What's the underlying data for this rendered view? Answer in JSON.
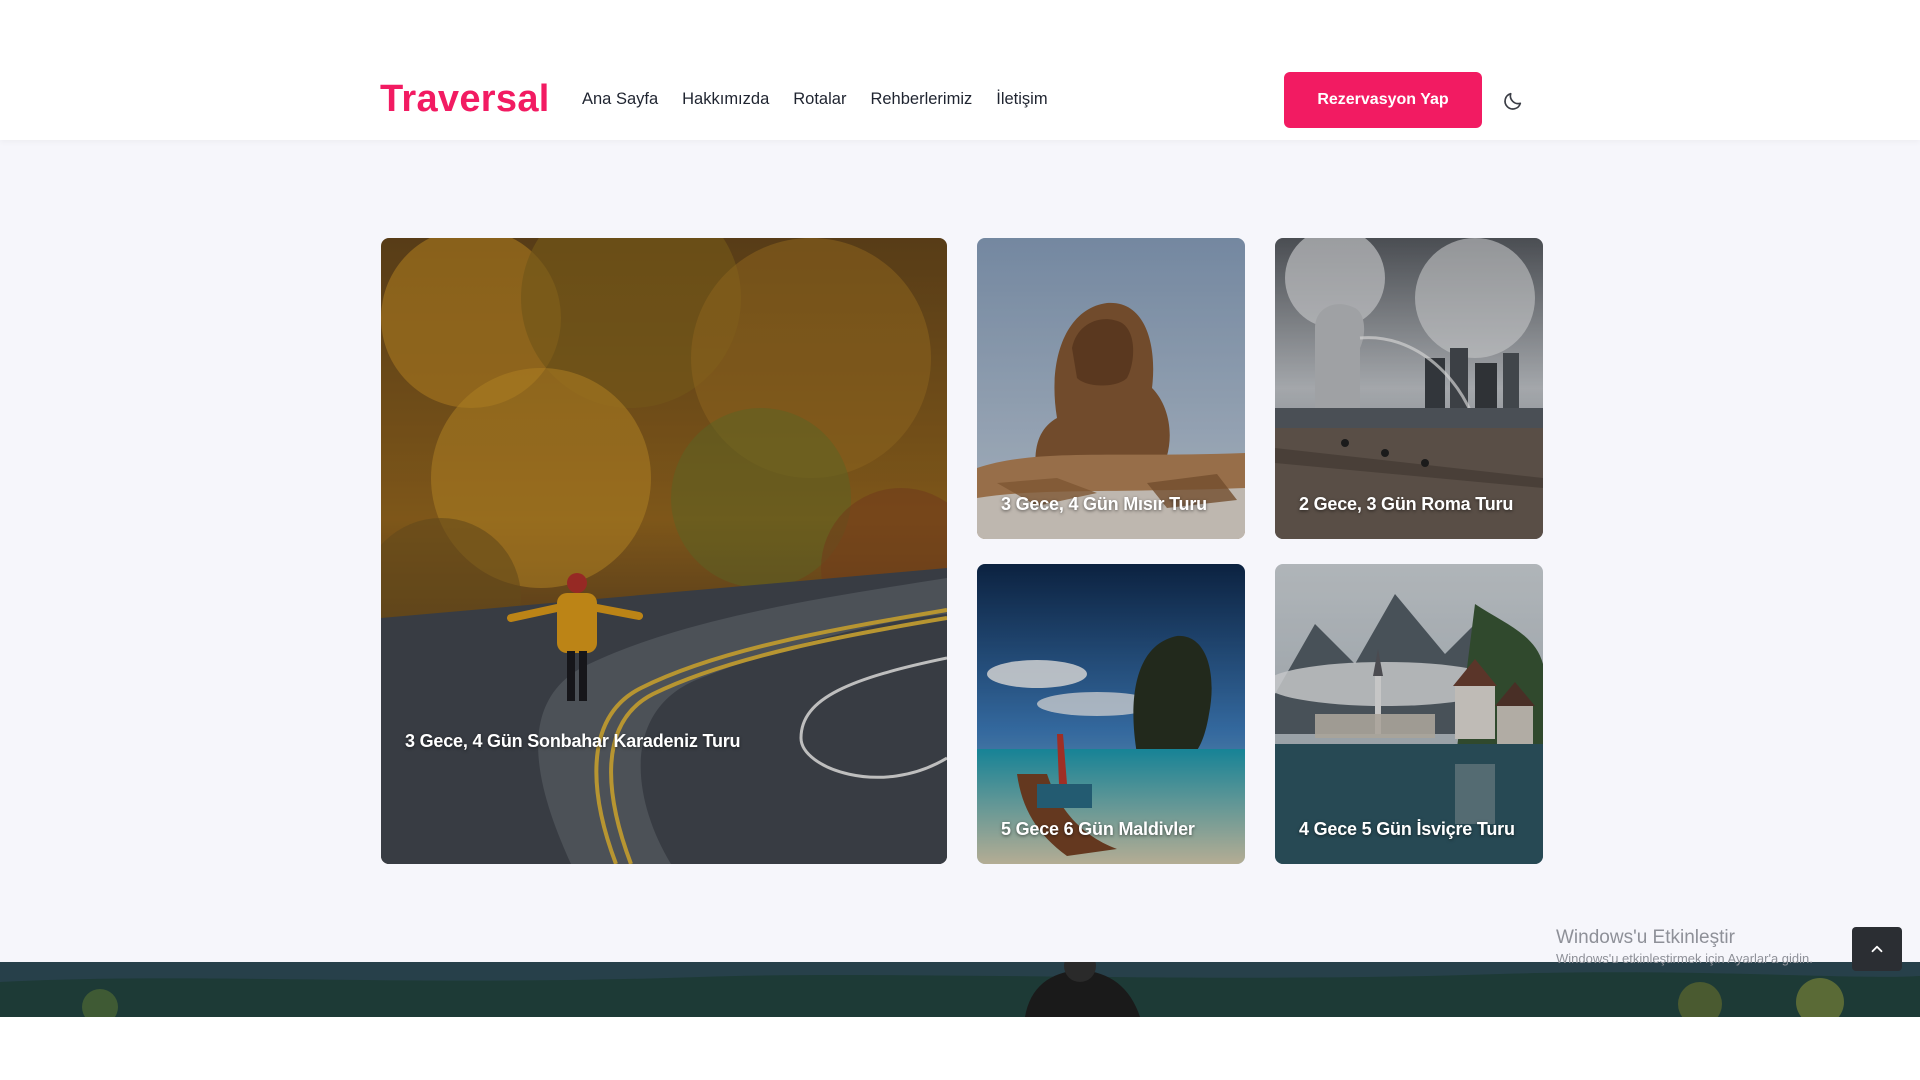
{
  "header": {
    "logo": "Traversal",
    "nav": [
      "Ana Sayfa",
      "Hakkımızda",
      "Rotalar",
      "Rehberlerimiz",
      "İletişim"
    ],
    "cta_label": "Rezervasyon Yap",
    "theme_icon": "moon-icon"
  },
  "tours": [
    {
      "title": "3 Gece, 4 Gün Sonbahar Karadeniz Turu",
      "image": "autumn-forest-road"
    },
    {
      "title": "3 Gece, 4 Gün Mısır Turu",
      "image": "sphinx"
    },
    {
      "title": "2 Gece, 3 Gün Roma Turu",
      "image": "merlion-waterfront"
    },
    {
      "title": "5 Gece 6 Gün Maldivler",
      "image": "tropical-boat-beach"
    },
    {
      "title": "4 Gece 5 Gün İsviçre Turu",
      "image": "alpine-lake-village"
    }
  ],
  "windows_activation": {
    "title": "Windows'u Etkinleştir",
    "subtitle": "Windows'u etkinleştirmek için Ayarlar'a gidin."
  },
  "scroll_top_icon": "chevron-up-icon",
  "colors": {
    "brand": "#f21b62",
    "text": "#1f2430",
    "section_bg": "#f6f6fb"
  }
}
